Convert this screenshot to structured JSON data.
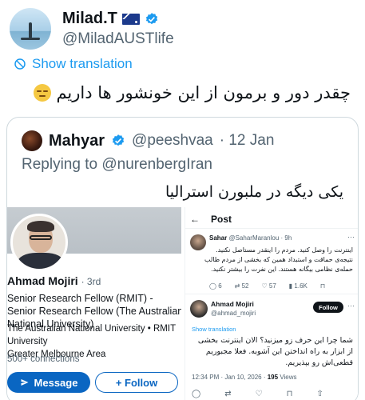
{
  "author": {
    "display_name": "Milad.T",
    "handle": "@MiladAUSTlife",
    "flag_icon": "australia-flag-icon",
    "verified_color": "#1d9bf0"
  },
  "translate": {
    "label": "Show translation"
  },
  "tweet": {
    "text": "چقدر دور و برمون از این خونشور ها داریم"
  },
  "quoted": {
    "display_name": "Mahyar",
    "handle": "@peeshvaa",
    "time": "· 12 Jan",
    "replying_to": "Replying to @nurenbergIran",
    "text": "یکی دیگه در ملبورن استرالیا"
  },
  "profile": {
    "name": "Ahmad Mojiri",
    "degree": "· 3rd",
    "bio": "Senior Research Fellow (RMIT) - Senior Research Fellow (The Australian National University)",
    "org": "The Australian National University • RMIT University",
    "location": "Greater Melbourne Area",
    "connections": "500+ connections",
    "message_label": "Message",
    "follow_label": "+ Follow"
  },
  "post": {
    "header_title": "Post",
    "sahar_name": "Sahar",
    "sahar_handle": "@SaharMaranlou · 9h",
    "sahar_text": "اینترنت را وصل کنید. مردم را اینقدر مستاصل نکنید. نتیجه‌ی حماقت و استبداد همین که بخشی از مردم طالب حمله‌ی نظامی بیگانه هستند. این نفرت را بیشتر نکنید.",
    "sahar_counts": {
      "replies": "6",
      "reposts": "52",
      "likes": "57",
      "views": "1.6K"
    },
    "ahmad_name": "Ahmad Mojiri",
    "ahmad_handle": "@ahmad_mojiri",
    "follow_label": "Follow",
    "translate_label": "Show translation",
    "ahmad_text": "شما چرا این حرف زو میزنید؟ الان اینترنت بخشی از ابزار به راه انداختن این آشوبه. فعلا مجبوریم قطعی‌اش رو بپذیریم.",
    "time": "12:34 PM · Jan 10, 2026 ·",
    "views": "195",
    "views_label": "Views"
  }
}
